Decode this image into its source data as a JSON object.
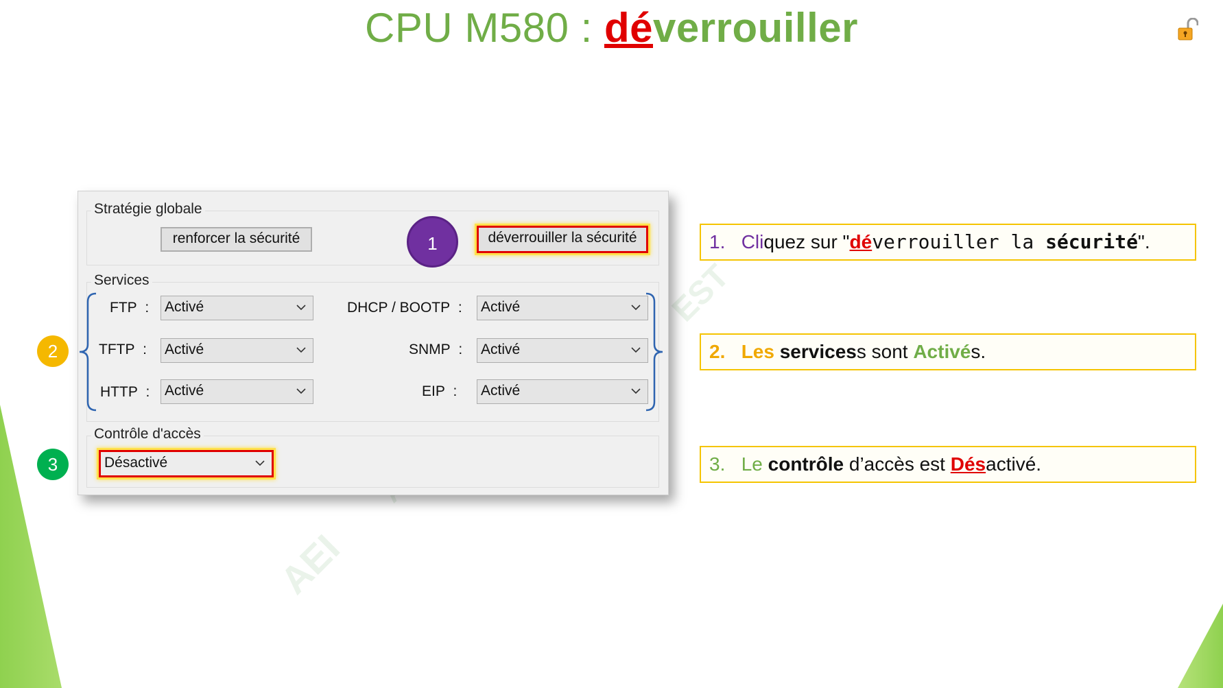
{
  "slide": {
    "title_prefix": "CPU M580 : ",
    "title_red": "dé",
    "title_rest": "verrouiller"
  },
  "watermarks": [
    "AEI",
    "AEI",
    "EST"
  ],
  "panel": {
    "strategy_label": "Stratégie globale",
    "reinforce_button": "renforcer la sécurité",
    "unlock_button": "déverrouiller la sécurité",
    "services_label": "Services",
    "services": [
      {
        "label": "FTP",
        "colon": ":",
        "value": "Activé"
      },
      {
        "label": "TFTP",
        "colon": ":",
        "value": "Activé"
      },
      {
        "label": "HTTP",
        "colon": ":",
        "value": "Activé"
      },
      {
        "label": "DHCP / BOOTP",
        "colon": ":",
        "value": "Activé"
      },
      {
        "label": "SNMP",
        "colon": ":",
        "value": "Activé"
      },
      {
        "label": "EIP",
        "colon": ":",
        "value": "Activé"
      }
    ],
    "access_label": "Contrôle d'accès",
    "access_value": "Désactivé"
  },
  "markers": [
    {
      "number": "1",
      "color": "#7030a0"
    },
    {
      "number": "2",
      "color": "#f5b800"
    },
    {
      "number": "3",
      "color": "#00b050"
    }
  ],
  "steps": {
    "step1": {
      "num": "1.",
      "a": "Cli",
      "b": "quez sur \"",
      "red": "dé",
      "mono": "verrouiller la ",
      "mono_bold": "sécurité",
      "end": "\"."
    },
    "step2": {
      "num": "2.",
      "a": "Les ",
      "b": "services",
      "c": "s sont ",
      "d": "Activé",
      "e": "s."
    },
    "step3": {
      "num": "3.",
      "a": "Le ",
      "b": "contrôle",
      "c": " d’accès est ",
      "d": "Dés",
      "e": "activé."
    }
  },
  "colors": {
    "accent_green": "#70ad47",
    "highlight_red": "#e00000",
    "callout_border": "#f5c400"
  }
}
